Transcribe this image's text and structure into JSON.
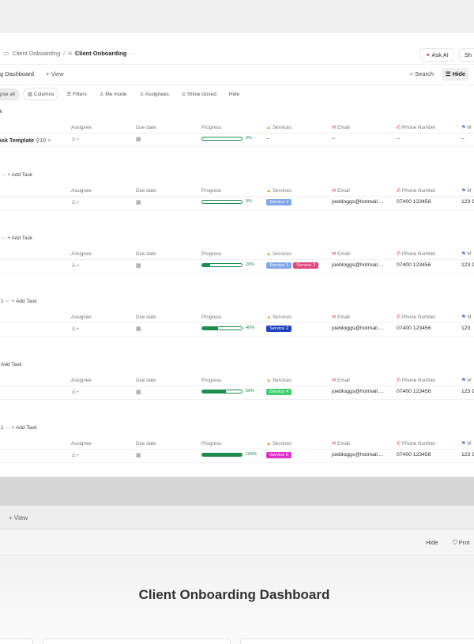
{
  "breadcrumb": {
    "parent": "Client Onboarding",
    "current": "Client Onboarding",
    "more": "···"
  },
  "topbar": {
    "ask_ai": "Ask AI",
    "share": "Sh"
  },
  "viewbar": {
    "tab": "g Dashboard",
    "add_view": "+ View",
    "search": "Search",
    "hide": "Hide"
  },
  "filters": {
    "collapse": "pse all",
    "columns": "Columns",
    "filters": "Filters",
    "me_mode": "Me mode",
    "assignees": "Assignees",
    "show_closed": "Show closed",
    "hide": "Hide"
  },
  "columns": {
    "assignee": "Assignee",
    "due": "Due date",
    "progress": "Progress",
    "services": "Services",
    "email": "Email",
    "phone": "Phone Number",
    "m": "M"
  },
  "groups": [
    {
      "head": "k",
      "task_title": "ask Template",
      "subtasks": "10",
      "progress": "0%",
      "progress_value": 0,
      "services": "–",
      "email": "–",
      "phone": "–",
      "m": "–"
    },
    {
      "head": "··· + Add Task",
      "progress": "0%",
      "progress_value": 0,
      "services": [
        "Service 1"
      ],
      "email": "joebloggs@hotmail....",
      "phone": "07400 123456",
      "m": "123 C"
    },
    {
      "head": "··· + Add Task",
      "progress": "20%",
      "progress_value": 20,
      "services": [
        "Service 1",
        "Service 3"
      ],
      "email": "joebloggs@hotmail....",
      "phone": "07400 123456",
      "m": "123 C"
    },
    {
      "head": "1 ··· + Add Task",
      "progress": "40%",
      "progress_value": 40,
      "services": [
        "Service 2"
      ],
      "email": "joebloggs@hotmail....",
      "phone": "07400 123456",
      "m": "123"
    },
    {
      "head": "Add Task",
      "progress": "60%",
      "progress_value": 60,
      "services": [
        "Service 4"
      ],
      "email": "joebloggs@hotmail....",
      "phone": "07400 123456",
      "m": "123 C"
    },
    {
      "head": "1 ··· + Add Task",
      "progress": "100%",
      "progress_value": 100,
      "services": [
        "Service 5"
      ],
      "email": "joebloggs@hotmail....",
      "phone": "07400 123456",
      "m": "123 C"
    }
  ],
  "tag_colors": {
    "Service 1": "#7fa6e8",
    "Service 2": "#1f3fbf",
    "Service 3": "#e0457b",
    "Service 4": "#3fcf6a",
    "Service 5": "#e02fc7"
  },
  "lower": {
    "add_view": "+ View",
    "hide": "Hide",
    "protect": "Prot",
    "dashboard_title": "Client Onboarding Dashboard"
  }
}
